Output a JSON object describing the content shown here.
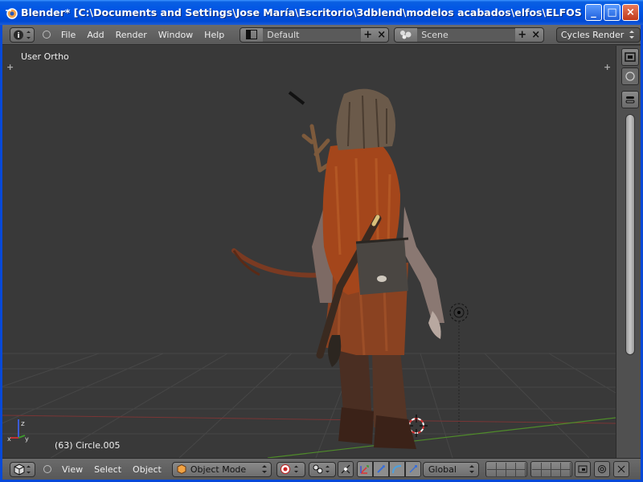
{
  "window": {
    "title": "Blender* [C:\\Documents and Settings\\Jose María\\Escritorio\\3dblend\\modelos acabados\\elfos\\ELFOS SALVAJES\\...",
    "minimize": "_",
    "maximize": "□",
    "close": "×"
  },
  "info_header": {
    "menus": [
      "File",
      "Add",
      "Render",
      "Window",
      "Help"
    ],
    "screen_layout": "Default",
    "scene": "Scene",
    "render_engine": "Cycles Render",
    "add_glyph": "+",
    "remove_glyph": "×"
  },
  "viewport": {
    "view_label": "User Ortho",
    "object_label": "(63) Circle.005",
    "corner_plus": "+"
  },
  "view_header": {
    "menus": [
      "View",
      "Select",
      "Object"
    ],
    "mode": "Object Mode",
    "orientation": "Global"
  },
  "colors": {
    "xp_titlebar": "#0055e5",
    "blender_header": "#6b6b6b",
    "viewport_bg": "#393939",
    "grid_line": "#4a4a4a",
    "x_axis": "#9e3a3a",
    "y_axis": "#5a9e2e"
  }
}
